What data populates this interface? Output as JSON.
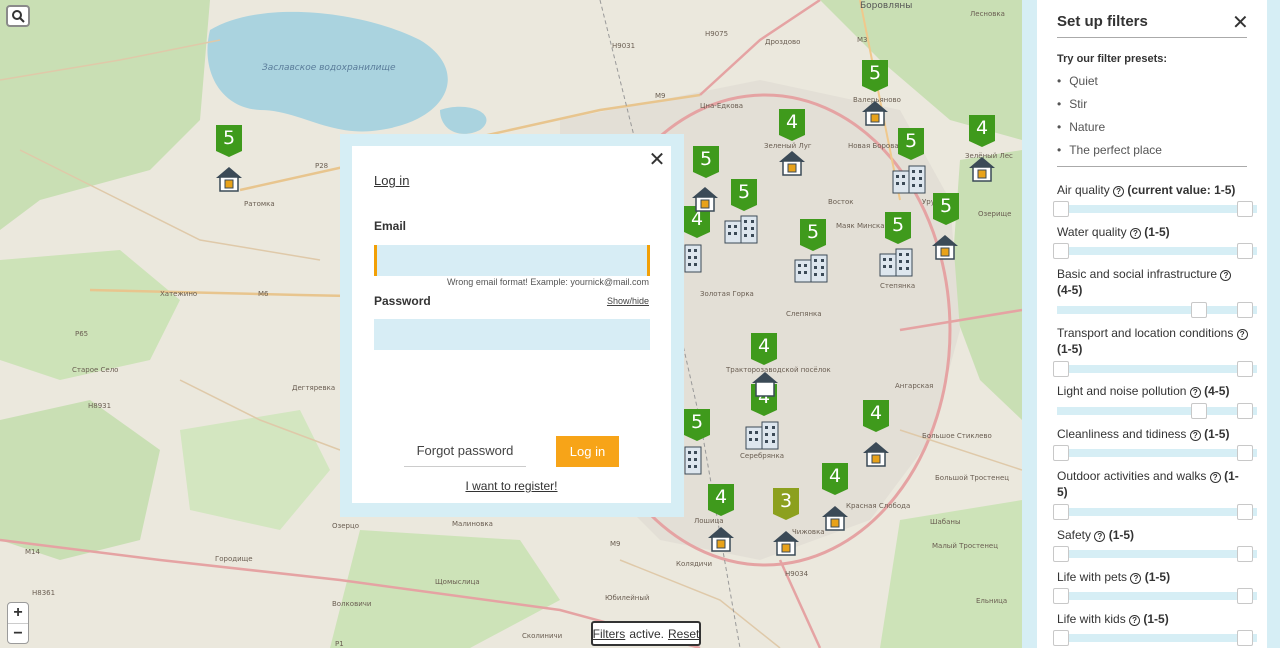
{
  "map": {
    "search_icon": "search-icon",
    "zoom_in": "+",
    "zoom_out": "−",
    "labels": {
      "borovlyany": "Боровляны",
      "lesnovka": "Лесновка",
      "reservoir": "Заславское водохранилище",
      "ratomka": "Ратомка",
      "tsna": "Цна-Едкова",
      "drozdovo": "Дроздово",
      "valerianovo": "Валерьяново",
      "zeleny": "Зеленый Луг",
      "novaya_borovaya": "Новая Боровая",
      "kopishche": "Копище",
      "vostok": "Восток",
      "mayak": "Маяк Минска",
      "uruchye": "Уручье",
      "zelenyi_les": "Зелёный Лес",
      "ozertse": "Озерище",
      "stepyanka": "Степянка",
      "slepyanka": "Слепянка",
      "zolotaya_gorka": "Золотая Горка",
      "ratomka2": "Хатежино",
      "starye_selo": "Старое Село",
      "degtyarevka": "Дегтяревка",
      "traktor": "Тракторозаводской посёлок",
      "angarskaya": "Ангарская",
      "serebryanka": "Серебрянка",
      "bolshoy": "Большое Стиклево",
      "bolshoy_trostenets": "Большой Тростенец",
      "malinovka": "Малиновка",
      "chizhovka": "Чижовка",
      "loshitsa": "Лошица",
      "krasnaya": "Красная Слобода",
      "shabany": "Шабаны",
      "maly_trostenets": "Малый Тростенец",
      "ozertso": "Озерцо",
      "gorodische": "Городище",
      "koldischi": "Колядичи",
      "yubileyny": "Юбилейный",
      "shchomyslitsa": "Щомыслица",
      "volkovichi": "Волковичи",
      "skorinichi": "Сколиничи",
      "elnitsa": "Ельница",
      "m14": "M14",
      "m9": "M9",
      "m6": "M6",
      "m3": "M3",
      "p28": "P28",
      "p65": "P65",
      "h9031": "H9031",
      "h9075": "H9075",
      "h8931": "H8931",
      "h8361": "H8361",
      "h9034": "H9034",
      "p1": "P1"
    },
    "markers": [
      "5",
      "5",
      "5",
      "4",
      "5",
      "5",
      "4",
      "5",
      "4",
      "5",
      "5",
      "5",
      "4",
      "4",
      "5",
      "4",
      "4",
      "4",
      "3"
    ],
    "filter_status": {
      "filters": "Filters",
      "active": "active.",
      "reset": "Reset"
    }
  },
  "modal": {
    "title_link": "Log in",
    "email_label": "Email",
    "email_value": "",
    "email_error": "Wrong email format! Example: yournick@mail.com",
    "password_label": "Password",
    "show_hide": "Show/hide",
    "password_value": "",
    "forgot": "Forgot password",
    "login_button": "Log in",
    "register": "I want to register!"
  },
  "sidebar": {
    "title": "Set up filters",
    "presets_title": "Try our filter presets:",
    "presets": [
      "Quiet",
      "Stir",
      "Nature",
      "The perfect place"
    ],
    "filters": [
      {
        "label": "Air quality",
        "value": "(current value: 1-5)",
        "min": 1,
        "max": 5
      },
      {
        "label": "Water quality",
        "value": "(1-5)",
        "min": 1,
        "max": 5
      },
      {
        "label": "Basic and social infrastructure",
        "value": "(4-5)",
        "min": 4,
        "max": 5
      },
      {
        "label": "Transport and location conditions",
        "value": "(1-5)",
        "min": 1,
        "max": 5
      },
      {
        "label": "Light and noise pollution",
        "value": "(4-5)",
        "min": 4,
        "max": 5
      },
      {
        "label": "Cleanliness and tidiness",
        "value": "(1-5)",
        "min": 1,
        "max": 5
      },
      {
        "label": "Outdoor activities and walks",
        "value": "(1-5)",
        "min": 1,
        "max": 5
      },
      {
        "label": "Safety",
        "value": "(1-5)",
        "min": 1,
        "max": 5
      },
      {
        "label": "Life with pets",
        "value": "(1-5)",
        "min": 1,
        "max": 5
      },
      {
        "label": "Life with kids",
        "value": "(1-5)",
        "min": 1,
        "max": 5
      }
    ]
  },
  "colors": {
    "accent": "#f7a418",
    "panel": "#d6eef5",
    "marker_green": "#3f9a1c",
    "marker_olive": "#8ca01e"
  }
}
